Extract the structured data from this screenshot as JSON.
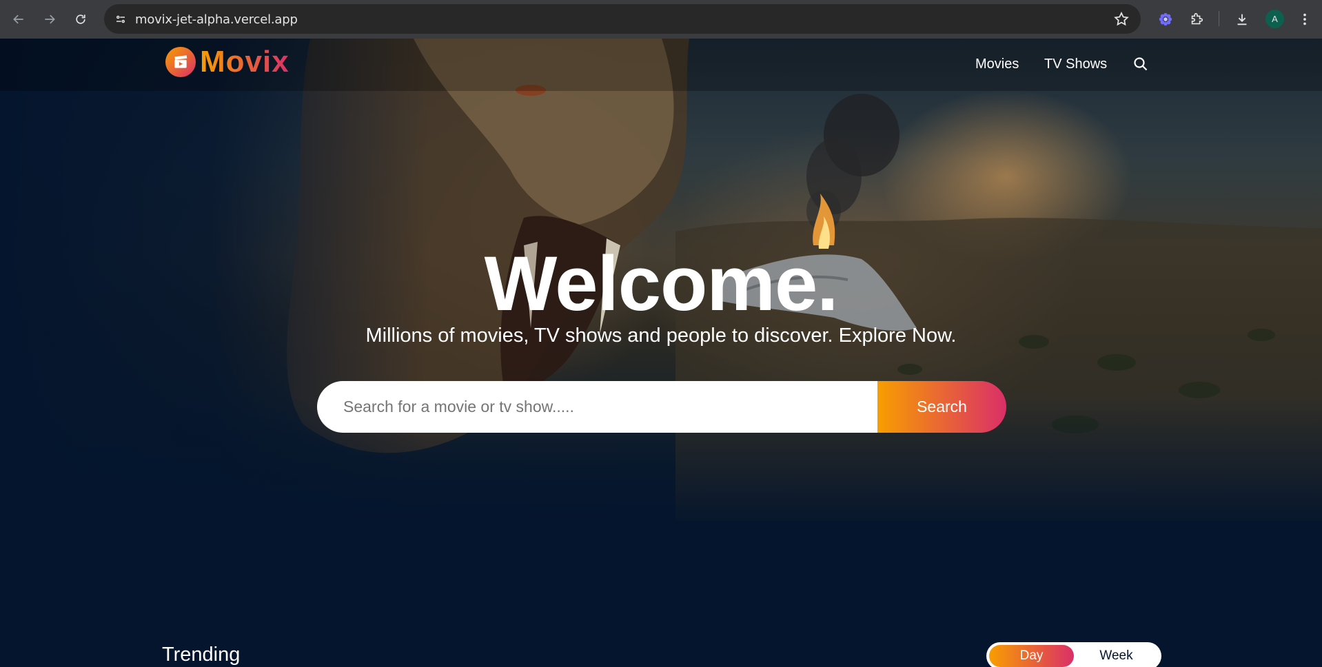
{
  "browser": {
    "url": "movix-jet-alpha.vercel.app",
    "profile_initial": "A",
    "icons": [
      "back-icon",
      "forward-icon",
      "reload-icon",
      "site-info-icon",
      "bookmark-star-icon",
      "extension-puzzle-icon",
      "download-icon",
      "more-icon"
    ]
  },
  "header": {
    "logo_text": "Movix",
    "nav": [
      {
        "label": "Movies"
      },
      {
        "label": "TV Shows"
      }
    ]
  },
  "hero": {
    "title": "Welcome.",
    "subtitle": "Millions of movies, TV shows and people to discover. Explore Now.",
    "search_placeholder": "Search for a movie or tv show.....",
    "search_button": "Search"
  },
  "trending": {
    "title": "Trending",
    "tabs": [
      {
        "label": "Day",
        "active": true
      },
      {
        "label": "Week",
        "active": false
      }
    ]
  },
  "colors": {
    "accent_start": "#f89e00",
    "accent_end": "#da2f68",
    "page_bg": "#04152d"
  }
}
